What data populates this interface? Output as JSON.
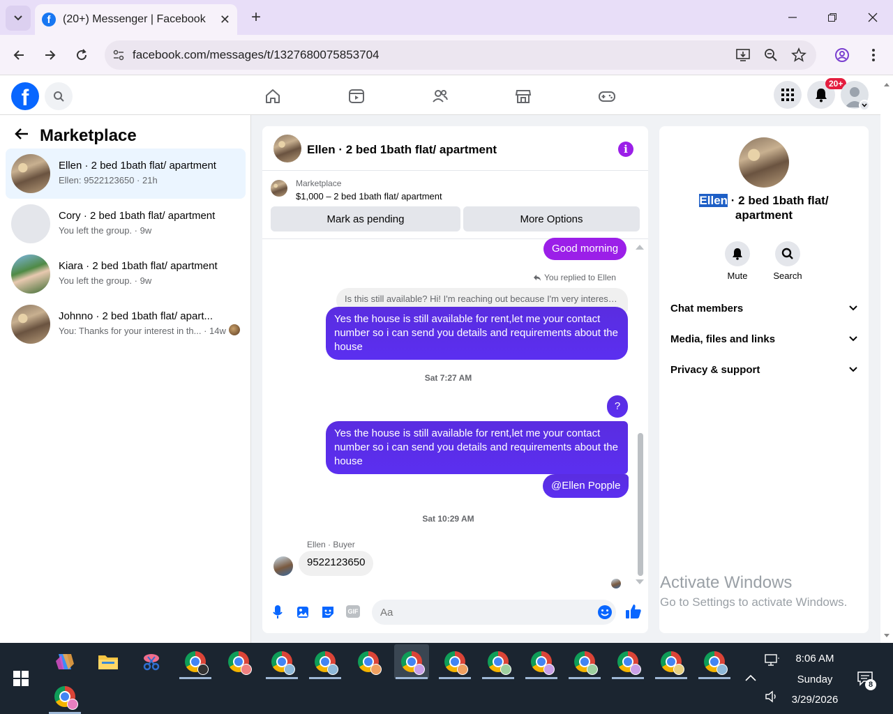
{
  "browser": {
    "tab_title": "(20+) Messenger | Facebook",
    "tab_close": "✕",
    "new_tab": "+",
    "url": "facebook.com/messages/t/1327680075853704"
  },
  "fb_header": {
    "logo_letter": "f",
    "notifications_badge": "20+"
  },
  "left_panel": {
    "back": "←",
    "title": "Marketplace",
    "conversations": [
      {
        "name": "Ellen · 2 bed 1bath flat/ apartment",
        "sub": "Ellen: 9522123650 · 21h"
      },
      {
        "name": "Cory · 2 bed 1bath flat/ apartment",
        "sub": "You left the group. · 9w"
      },
      {
        "name": "Kiara · 2 bed 1bath flat/ apartment",
        "sub": "You left the group. · 9w"
      },
      {
        "name": "Johnno · 2 bed 1bath flat/ apart...",
        "sub": "You: Thanks for your interest in th... · 14w"
      }
    ]
  },
  "chat": {
    "title": "Ellen · 2 bed 1bath flat/ apartment",
    "info_icon": "i",
    "listing_source": "Marketplace",
    "listing_price": "$1,000 – 2 bed 1bath flat/ apartment",
    "mark_pending": "Mark as pending",
    "more_options": "More Options",
    "messages": {
      "m1": "Good morning",
      "replied": "You replied to Ellen",
      "quoted": "Is this still available? Hi! I'm reaching out because I'm very intereste...",
      "m2": "Yes the house is still available for rent,let me your contact number so i can send you details and requirements about the house",
      "ts1": "Sat 7:27 AM",
      "m3": "?",
      "m4": "Yes the house is still available for rent,let me your contact number so i can send you details and requirements about the house",
      "m5": "@Ellen Popple",
      "ts2": "Sat 10:29 AM",
      "sender_label": "Ellen · Buyer",
      "m6": "9522123650"
    },
    "input_placeholder": "Aa",
    "gif_label": "GIF"
  },
  "right_panel": {
    "name_highlight": "Ellen",
    "name_rest": " · 2 bed 1bath flat/ apartment",
    "mute": "Mute",
    "search": "Search",
    "chat_members": "Chat members",
    "media": "Media, files and links",
    "privacy": "Privacy & support",
    "chevron": "⌄"
  },
  "watermark": {
    "line1": "Activate Windows",
    "line2": "Go to Settings to activate Windows."
  },
  "taskbar": {
    "time": "8:06 AM",
    "day": "Sunday",
    "date": "3/29/2026",
    "notif_count": "8"
  },
  "colors": {
    "accent_purple": "#5b2ff0",
    "fb_blue": "#0866ff",
    "badge_red": "#e41e3f"
  }
}
